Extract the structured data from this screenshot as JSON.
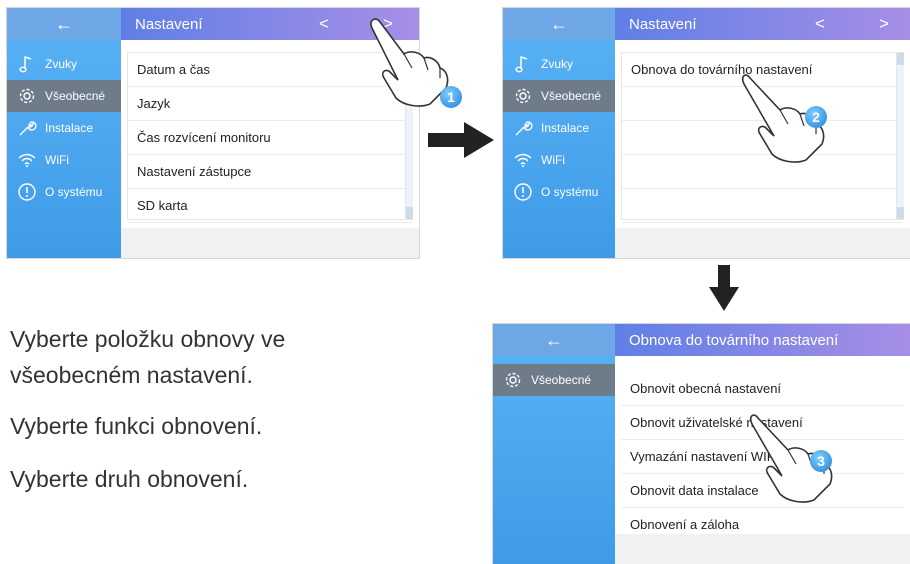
{
  "icons": {
    "back": "←",
    "prev": "<",
    "next": ">"
  },
  "sidebar_menu": [
    {
      "label": "Zvuky",
      "icon": "music-note-icon"
    },
    {
      "label": "Všeobecné",
      "icon": "gear-icon"
    },
    {
      "label": "Instalace",
      "icon": "wrench-icon"
    },
    {
      "label": "WiFi",
      "icon": "wifi-icon"
    },
    {
      "label": "O systému",
      "icon": "info-icon"
    }
  ],
  "screen1": {
    "title": "Nastavení",
    "items": [
      "Datum a čas",
      "Jazyk",
      "Čas rozvícení monitoru",
      "Nastavení zástupce",
      "SD karta"
    ],
    "step": "1"
  },
  "screen2": {
    "title": "Nastavení",
    "items": [
      "Obnova do továrního nastavení"
    ],
    "step": "2"
  },
  "screen3": {
    "title": "Obnova do továrního nastavení",
    "sidebar_item": "Všeobecné",
    "items": [
      "Obnovit obecná nastavení",
      "Obnovit uživatelské nastavení",
      "Vymazání nastavení WIFI",
      "Obnovit data instalace",
      "Obnovení a záloha"
    ],
    "step": "3"
  },
  "captions": {
    "line1a": "Vyberte položku obnovy  ve",
    "line1b": " všeobecném  nastavení.",
    "line2": "Vyberte funkci obnovení.",
    "line3": "Vyberte druh obnovení."
  }
}
